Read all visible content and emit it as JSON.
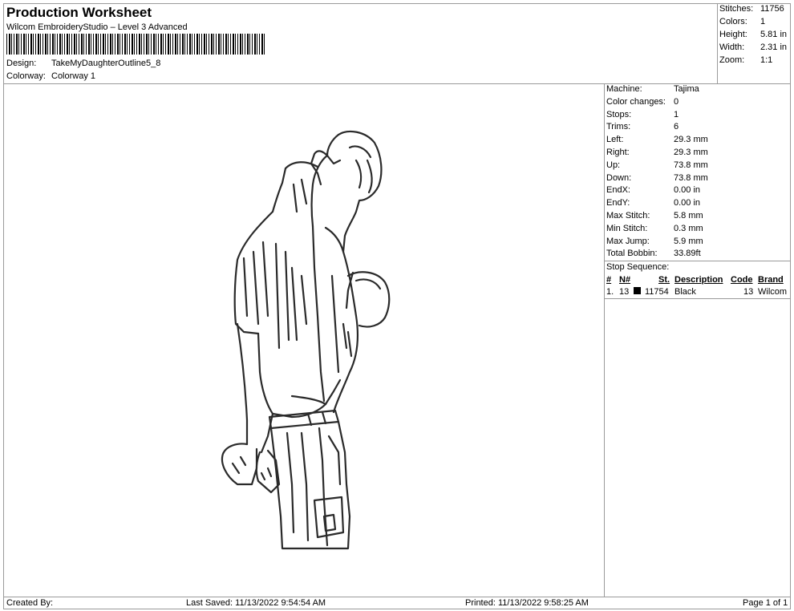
{
  "header": {
    "title": "Production Worksheet",
    "software": "Wilcom EmbroideryStudio – Level 3 Advanced",
    "design_label": "Design:",
    "design_value": "TakeMyDaughterOutline5_8",
    "colorway_label": "Colorway:",
    "colorway_value": "Colorway 1"
  },
  "summary": [
    {
      "label": "Stitches:",
      "value": "11756"
    },
    {
      "label": "Colors:",
      "value": "1"
    },
    {
      "label": "Height:",
      "value": "5.81 in"
    },
    {
      "label": "Width:",
      "value": "2.31 in"
    },
    {
      "label": "Zoom:",
      "value": "1:1"
    }
  ],
  "machine_stats": [
    {
      "label": "Machine:",
      "value": "Tajima"
    },
    {
      "label": "Color changes:",
      "value": "0"
    },
    {
      "label": "Stops:",
      "value": "1"
    },
    {
      "label": "Trims:",
      "value": "6"
    },
    {
      "label": "Left:",
      "value": "29.3 mm"
    },
    {
      "label": "Right:",
      "value": "29.3 mm"
    },
    {
      "label": "Up:",
      "value": "73.8 mm"
    },
    {
      "label": "Down:",
      "value": "73.8 mm"
    },
    {
      "label": "EndX:",
      "value": "0.00 in"
    },
    {
      "label": "EndY:",
      "value": "0.00 in"
    },
    {
      "label": "Max Stitch:",
      "value": "5.8 mm"
    },
    {
      "label": "Min Stitch:",
      "value": "0.3 mm"
    },
    {
      "label": "Max Jump:",
      "value": "5.9 mm"
    },
    {
      "label": "Total Bobbin:",
      "value": "33.89ft"
    }
  ],
  "stop_sequence": {
    "title": "Stop Sequence:",
    "headers": {
      "num": "#",
      "needle": "N#",
      "stitches": "St.",
      "description": "Description",
      "code": "Code",
      "brand": "Brand"
    },
    "rows": [
      {
        "num": "1.",
        "needle": "13",
        "color": "#000000",
        "stitches": "11754",
        "description": "Black",
        "code": "13",
        "brand": "Wilcom"
      }
    ]
  },
  "footer": {
    "created_by": "Created By:",
    "last_saved": "Last Saved: 11/13/2022 9:54:54 AM",
    "printed": "Printed: 11/13/2022 9:58:25 AM",
    "page": "Page 1 of 1"
  }
}
